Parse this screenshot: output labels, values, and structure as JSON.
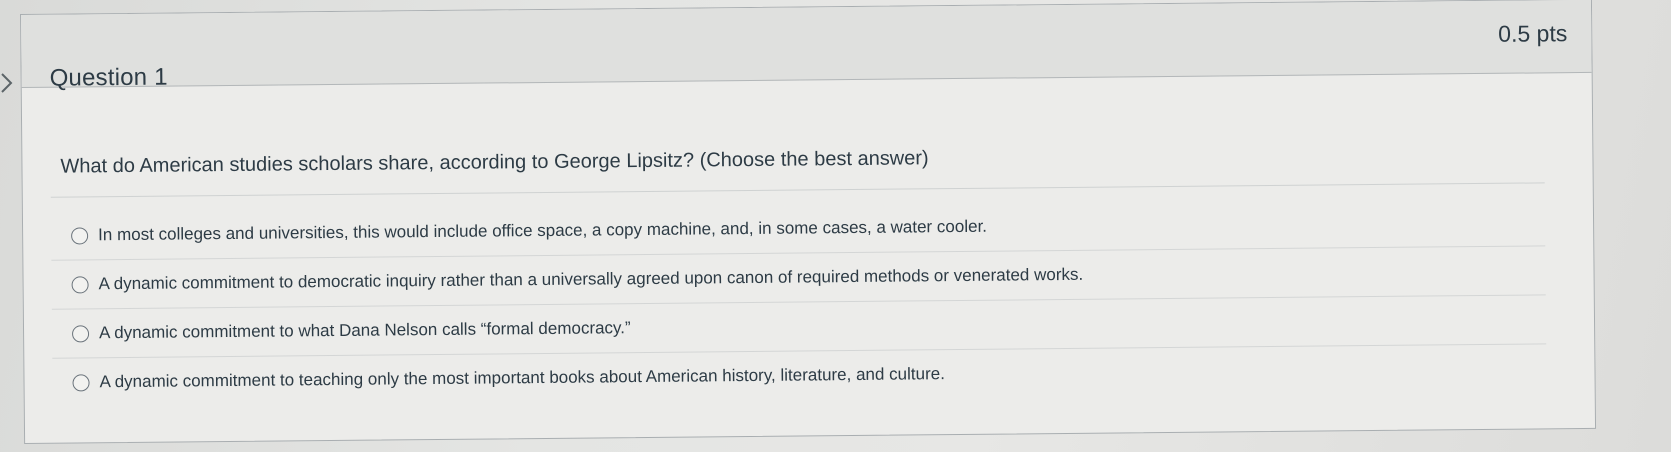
{
  "question": {
    "title": "Question 1",
    "points": "0.5 pts",
    "text": "What do American studies scholars share, according to George Lipsitz? (Choose the best answer)",
    "answers": [
      "In most colleges and universities, this would include office space, a copy machine, and, in some cases, a water cooler.",
      "A dynamic commitment to democratic inquiry rather than a universally agreed upon canon of required methods or venerated works.",
      "A dynamic commitment to what Dana Nelson calls “formal democracy.”",
      "A dynamic commitment to teaching only the most important books about American history, literature, and culture."
    ]
  },
  "icons": {
    "collapse": "chevron-right-icon",
    "radio": "radio-unchecked-icon"
  }
}
